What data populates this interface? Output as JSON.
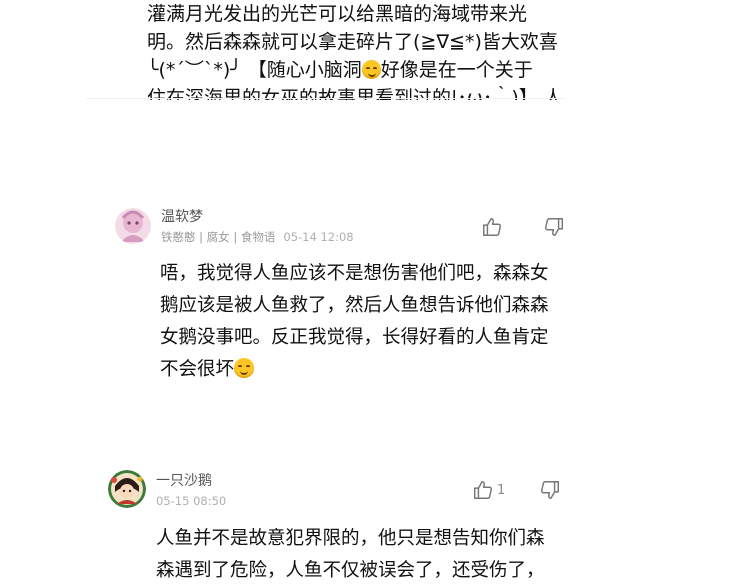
{
  "prev_comment": {
    "lines": [
      "灌满月光发出的光芒可以给黑暗的海域带来光",
      "明。然后森森就可以拿走碎片了(≧∇≦*)皆大欢喜",
      "╰(*´︶`*)╯ 【随心小脑洞",
      "好像是在一个关于",
      "住在深海里的女巫的故事里看到过的|･ω･｀)】 人"
    ]
  },
  "comments": [
    {
      "username": "温软梦",
      "tags": "铁憨憨 | 腐女 | 食物语",
      "time": "05-14 12:08",
      "like_count": "",
      "body_lines": [
        "唔，我觉得人鱼应该不是想伤害他们吧，森森女",
        "鹅应该是被人鱼救了，然后人鱼想告诉他们森森",
        "女鹅没事吧。反正我觉得，长得好看的人鱼肯定",
        "不会很坏"
      ]
    },
    {
      "username": "一只沙鹅",
      "tags": "",
      "time": "05-15 08:50",
      "like_count": "1",
      "body_lines": [
        "人鱼并不是故意犯界限的，他只是想告知你们森",
        "森遇到了危险，人鱼不仅被误会了，还受伤了，"
      ]
    }
  ],
  "icons": {
    "like": "thumbs-up-icon",
    "dislike": "thumbs-down-icon",
    "emoji_cry": "laugh-cry-emoji",
    "emoji_smile": "smile-emoji"
  },
  "colors": {
    "text": "#111111",
    "meta": "#a5a5a5",
    "username": "#555555",
    "icon": "#777777"
  }
}
